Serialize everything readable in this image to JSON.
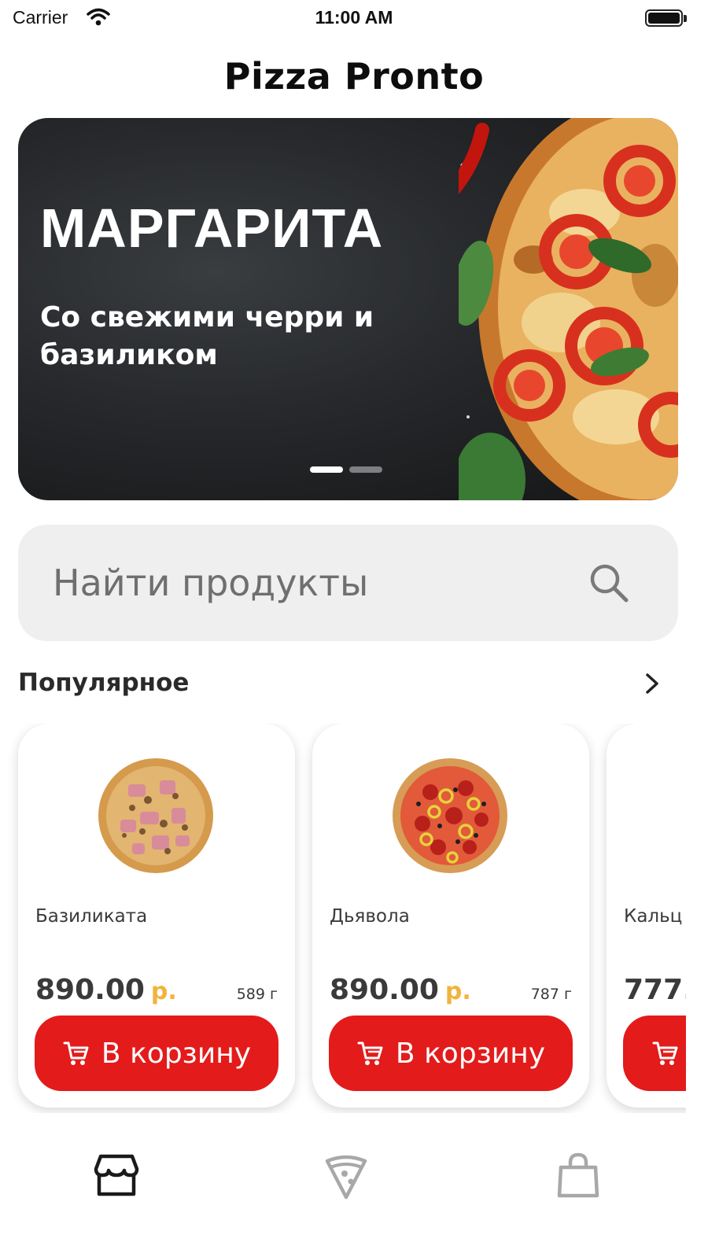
{
  "status_bar": {
    "carrier": "Carrier",
    "time": "11:00 AM"
  },
  "header": {
    "title": "Pizza Pronto"
  },
  "banner": {
    "title": "МАРГАРИТА",
    "subtitle": "Со свежими черри и базиликом",
    "slide_count": 2,
    "active_slide": 1
  },
  "search": {
    "placeholder": "Найти продукты",
    "icon": "search-icon"
  },
  "popular": {
    "title": "Популярное",
    "more_icon": "chevron-right-icon"
  },
  "products": [
    {
      "name": "Базиликата",
      "price": "890.00",
      "currency": "р.",
      "weight": "589 г",
      "button_label": "В корзину"
    },
    {
      "name": "Дьявола",
      "price": "890.00",
      "currency": "р.",
      "weight": "787 г",
      "button_label": "В корзину"
    },
    {
      "name": "Кальц",
      "price": "777.",
      "currency": "",
      "weight": "",
      "button_label": ""
    }
  ],
  "tab_bar": {
    "items": [
      {
        "icon": "shop-icon",
        "active": true
      },
      {
        "icon": "pizza-slice-icon",
        "active": false
      },
      {
        "icon": "shopping-bag-icon",
        "active": false
      }
    ]
  },
  "colors": {
    "accent": "#e31b1b",
    "currency": "#f2b33d",
    "search_bg": "#efefef",
    "tab_active": "#1a1a1a",
    "tab_inactive": "#a8a8a8"
  }
}
